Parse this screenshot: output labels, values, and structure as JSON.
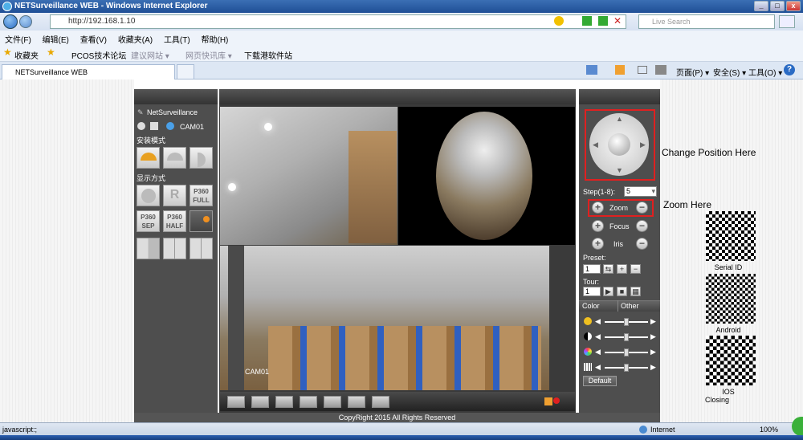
{
  "window": {
    "title": "NETSurveillance WEB - Windows Internet Explorer"
  },
  "address": {
    "url": "http://192.168.1.10",
    "search_placeholder": "Live Search"
  },
  "menu": [
    "文件(F)",
    "编辑(E)",
    "查看(V)",
    "收藏夹(A)",
    "工具(T)",
    "帮助(H)"
  ],
  "favorites": {
    "label": "收藏夹",
    "items": [
      "PCOS技术论坛",
      "建议网站 ▾",
      "网页快讯库 ▾",
      "下载港软件站"
    ]
  },
  "tab": {
    "title": "NETSurveillance WEB"
  },
  "commandbar": {
    "page": "页面(P) ▾",
    "safety": "安全(S) ▾",
    "tools": "工具(O) ▾",
    "help": "?"
  },
  "left_panel": {
    "brand": "NetSurveillance",
    "camera": "CAM01",
    "install_mode": "安装模式",
    "display_mode": "显示方式",
    "buttons": [
      "R",
      "P360\nFULL",
      "P360\nSEP",
      "P360\nHALF"
    ]
  },
  "video": {
    "channel_label": "CAM01"
  },
  "right_panel": {
    "step_label": "Step(1-8):",
    "step_value": "5",
    "zoom": "Zoom",
    "focus": "Focus",
    "iris": "Iris",
    "preset": "Preset:",
    "preset_value": "1",
    "tour": "Tour:",
    "tour_value": "1",
    "tab_color": "Color",
    "tab_other": "Other",
    "default_button": "Default"
  },
  "annotations": {
    "change_position": "Change Position Here",
    "zoom_here": "Zoom Here",
    "serial_id": "Serial ID",
    "android": "Android",
    "ios": "IOS",
    "closing": "Closing"
  },
  "footer": {
    "copyright": "CopyRight 2015 All Rights Reserved"
  },
  "status": {
    "left": "javascript:;",
    "zone": "Internet",
    "zoom": "100%"
  },
  "colors": {
    "highlight": "#e02020",
    "panel": "#4e4e4e",
    "ie_blue": "#1f4f96"
  }
}
